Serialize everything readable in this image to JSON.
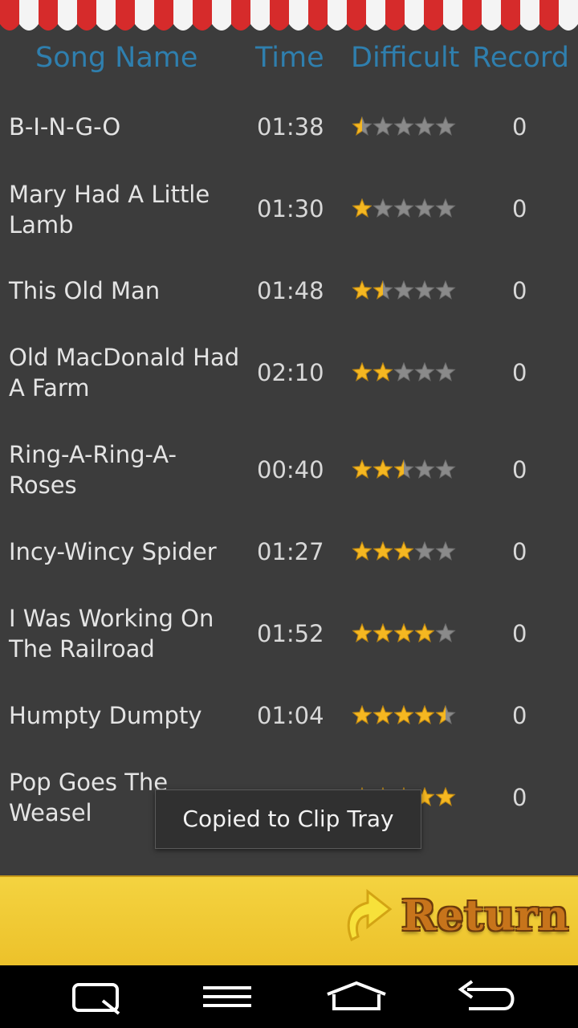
{
  "header": {
    "song_name": "Song Name",
    "time": "Time",
    "difficult": "Difficult",
    "record": "Record"
  },
  "songs": [
    {
      "name": "B-I-N-G-O",
      "time": "01:38",
      "difficulty": 0.5,
      "record": "0"
    },
    {
      "name": "Mary Had A Little Lamb",
      "time": "01:30",
      "difficulty": 1,
      "record": "0"
    },
    {
      "name": "This Old Man",
      "time": "01:48",
      "difficulty": 1.5,
      "record": "0"
    },
    {
      "name": "Old MacDonald Had A Farm",
      "time": "02:10",
      "difficulty": 2,
      "record": "0"
    },
    {
      "name": "Ring-A-Ring-A-Roses",
      "time": "00:40",
      "difficulty": 2.5,
      "record": "0"
    },
    {
      "name": "Incy-Wincy Spider",
      "time": "01:27",
      "difficulty": 3,
      "record": "0"
    },
    {
      "name": "I Was Working On The Railroad",
      "time": "01:52",
      "difficulty": 4,
      "record": "0"
    },
    {
      "name": "Humpty Dumpty",
      "time": "01:04",
      "difficulty": 4.5,
      "record": "0"
    },
    {
      "name": "Pop Goes The Weasel",
      "time": "",
      "difficulty": 5,
      "record": "0"
    }
  ],
  "toast": "Copied to Clip Tray",
  "footer": {
    "return_label": "Return"
  },
  "colors": {
    "star_on": "#f5b721",
    "star_off": "#8a8a8a",
    "header_text": "#2f7fae",
    "footer": "#f0c830"
  },
  "navbar_icons": [
    "recent-apps-icon",
    "menu-icon",
    "home-icon",
    "back-icon"
  ]
}
